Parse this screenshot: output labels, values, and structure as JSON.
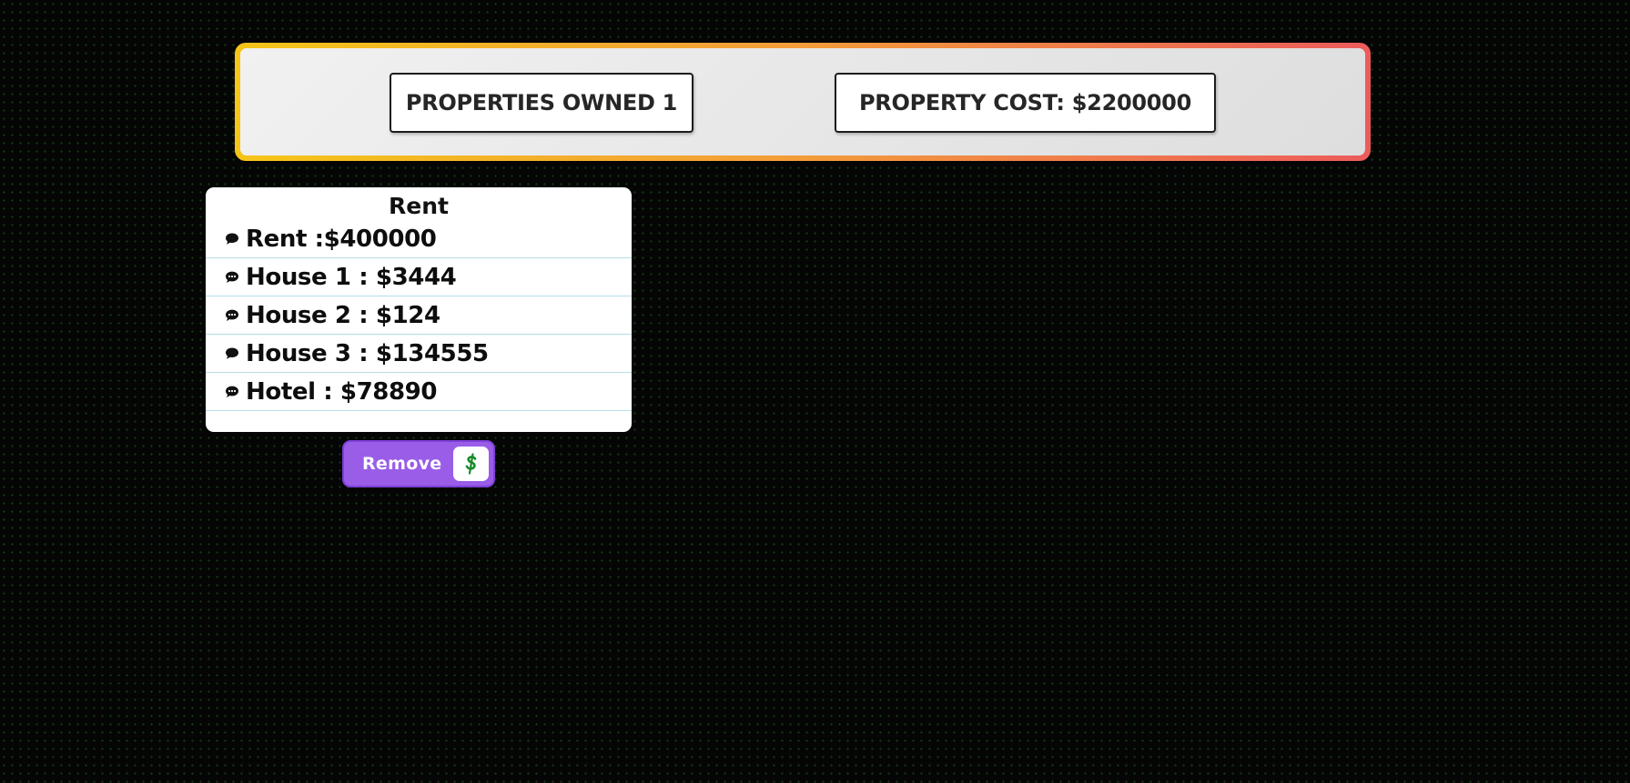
{
  "stats": {
    "properties_owned": "PROPERTIES OWNED 1",
    "property_cost": "PROPERTY COST: $2200000"
  },
  "rent_card": {
    "title": "Rent",
    "rows": [
      {
        "label": "Rent :$400000"
      },
      {
        "label": "House 1 : $3444"
      },
      {
        "label": "House 2 : $124"
      },
      {
        "label": "House 3 : $134555"
      },
      {
        "label": "Hotel : $78890"
      }
    ]
  },
  "remove_button": {
    "label": "Remove",
    "icon": "dollar-icon"
  },
  "colors": {
    "banner_gradient_start": "#f5c518",
    "banner_gradient_end": "#ec5b5b",
    "button_purple": "#9a5de8",
    "dollar_green": "#1a8a2a",
    "row_divider": "#b6dde7"
  }
}
